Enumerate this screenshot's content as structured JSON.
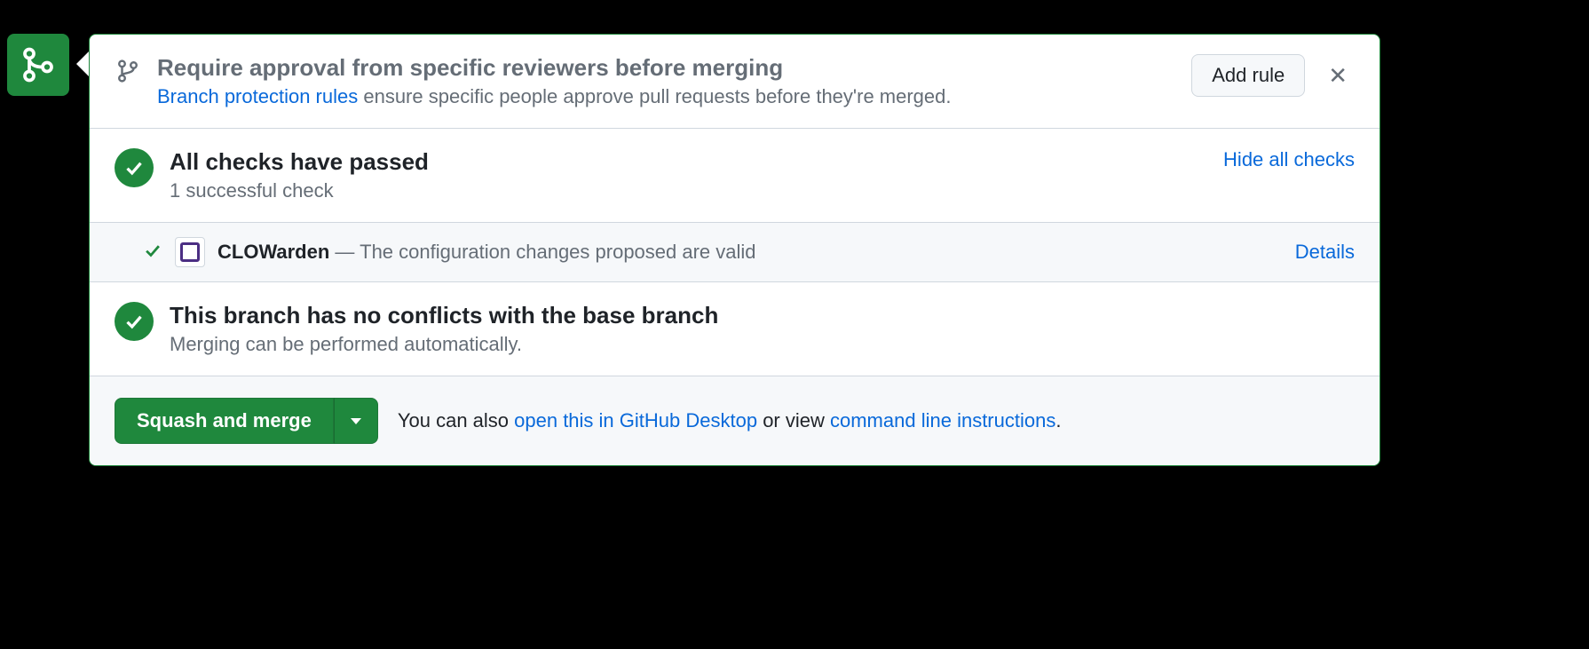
{
  "rule_banner": {
    "title": "Require approval from specific reviewers before merging",
    "link_text": "Branch protection rules",
    "desc_tail": " ensure specific people approve pull requests before they're merged.",
    "add_rule_label": "Add rule"
  },
  "checks": {
    "title": "All checks have passed",
    "subtitle": "1 successful check",
    "hide_link": "Hide all checks",
    "items": [
      {
        "name": "CLOWarden",
        "separator": " — ",
        "desc": "The configuration changes proposed are valid",
        "details_label": "Details"
      }
    ]
  },
  "conflicts": {
    "title": "This branch has no conflicts with the base branch",
    "subtitle": "Merging can be performed automatically."
  },
  "footer": {
    "merge_button": "Squash and merge",
    "text_prefix": "You can also ",
    "link1": "open this in GitHub Desktop",
    "text_mid": " or view ",
    "link2": "command line instructions",
    "text_suffix": "."
  }
}
